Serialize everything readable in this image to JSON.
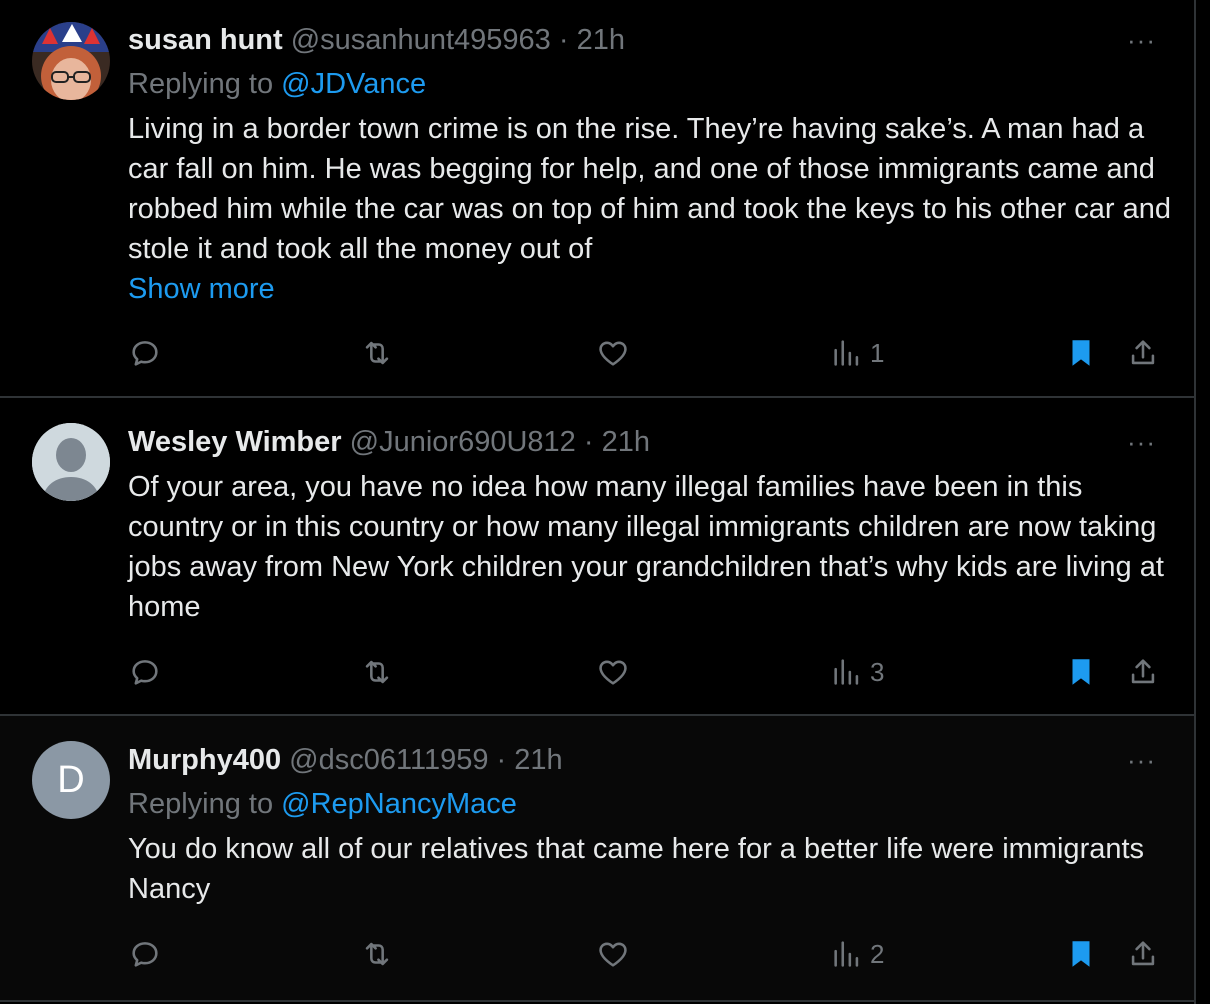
{
  "tweets": [
    {
      "name": "susan hunt",
      "handle": "@susanhunt495963",
      "time": "21h",
      "replying_label": "Replying to",
      "replying_to": "@JDVance",
      "text": "Living in a border town crime is on the rise. They’re having sake’s. A man had a car fall on him. He was begging for help, and one of those immigrants came and robbed him while the car was on top of him and took the keys to his other car and stole it and took all the money out of",
      "show_more": "Show more",
      "views": "1"
    },
    {
      "name": "Wesley Wimber",
      "handle": "@Junior690U812",
      "time": "21h",
      "text": "Of your area, you have no idea how many illegal families have been in this country or in this country or how many illegal immigrants children are now taking jobs away from New York children your grandchildren that’s why kids are living at home",
      "views": "3"
    },
    {
      "name": "Murphy400",
      "handle": "@dsc06111959",
      "time": "21h",
      "replying_label": "Replying to",
      "replying_to": "@RepNancyMace",
      "avatar_letter": "D",
      "text": "You do know all of our relatives that came here for a better life were immigrants Nancy",
      "views": "2"
    }
  ],
  "separator": "·",
  "more_glyph": "···",
  "colors": {
    "accent": "#1d9bf0",
    "muted": "#71767b",
    "text": "#e7e9ea",
    "bg": "#000000",
    "border": "#2f3336"
  },
  "icons": [
    "reply-icon",
    "retweet-icon",
    "like-icon",
    "views-icon",
    "bookmark-icon",
    "share-icon"
  ]
}
